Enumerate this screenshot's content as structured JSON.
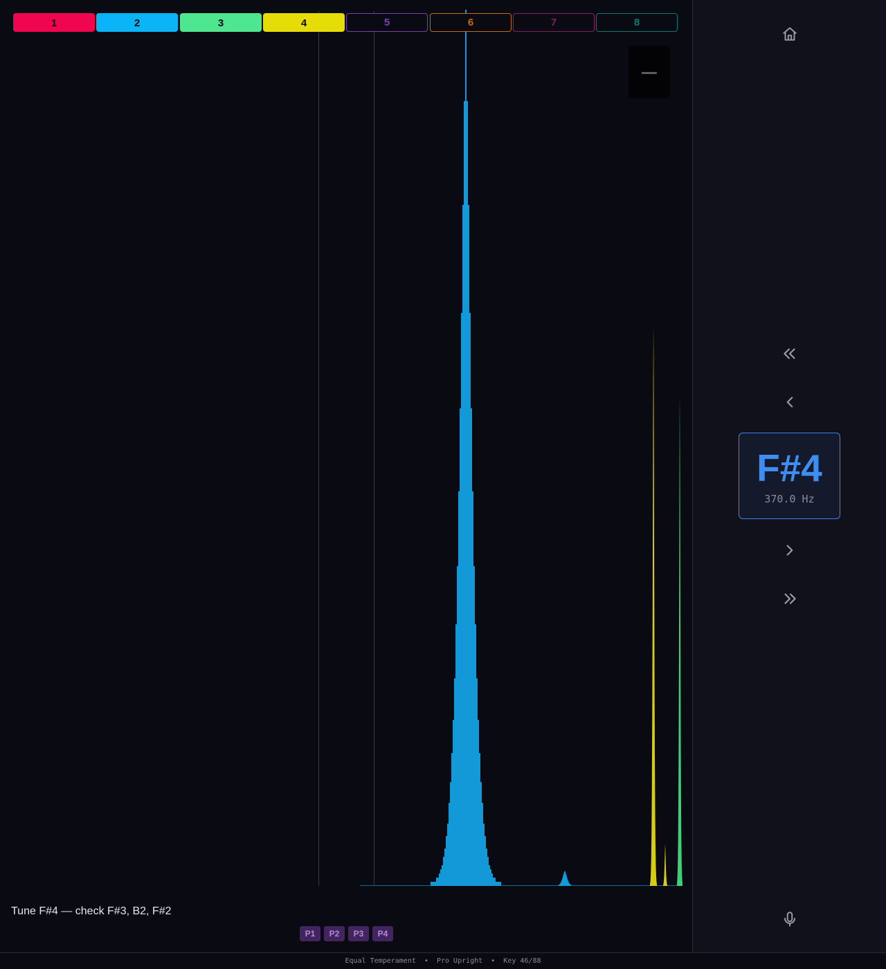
{
  "partials": [
    {
      "label": "1",
      "active": true,
      "color": "#f0064f"
    },
    {
      "label": "2",
      "active": true,
      "color": "#0bb4f6"
    },
    {
      "label": "3",
      "active": true,
      "color": "#4ee68f"
    },
    {
      "label": "4",
      "active": true,
      "color": "#e6dc08"
    },
    {
      "label": "5",
      "active": false,
      "color": "#7b3fb0"
    },
    {
      "label": "6",
      "active": false,
      "color": "#c86a12"
    },
    {
      "label": "7",
      "active": false,
      "color": "#8a1a6e"
    },
    {
      "label": "8",
      "active": false,
      "color": "#0f7a74"
    }
  ],
  "instruction": "Tune F#4 — check F#3, B2, F#2",
  "presets": [
    "P1",
    "P2",
    "P3",
    "P4"
  ],
  "note": {
    "name": "F#4",
    "frequency": "370.0 Hz"
  },
  "footer": {
    "temperament": "Equal Temperament",
    "piano": "Pro Upright",
    "key": "Key 46/88",
    "separator": "•"
  },
  "icons": {
    "home": "home-icon",
    "first": "chevrons-left-icon",
    "prev": "chevron-left-icon",
    "next": "chevron-right-icon",
    "last": "chevrons-right-icon",
    "mic": "microphone-icon",
    "minimize": "minus-icon"
  },
  "colors": {
    "background": "#0a0b12",
    "accent": "#3b82f6",
    "partial_2": "#0bb4f6",
    "partial_3": "#4ee68f",
    "partial_4": "#e6dc08"
  }
}
